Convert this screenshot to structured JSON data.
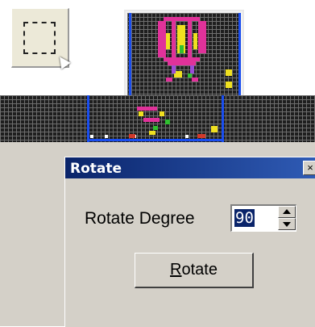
{
  "toolbar": {
    "selection_tool_icon": "rectangle-select-icon"
  },
  "dialog": {
    "title": "Rotate",
    "close_glyph": "×",
    "degree_label": "Rotate Degree",
    "degree_value": "90",
    "rotate_button_mnemonic": "R",
    "rotate_button_rest": "otate"
  },
  "colors": {
    "titlebar_start": "#0a246a",
    "titlebar_end": "#2f5bb5",
    "face": "#d4d0c8",
    "pixel_pink": "#e0329a",
    "pixel_yellow": "#f0e020",
    "pixel_blue": "#1a4ef0",
    "pixel_green": "#30c030"
  }
}
